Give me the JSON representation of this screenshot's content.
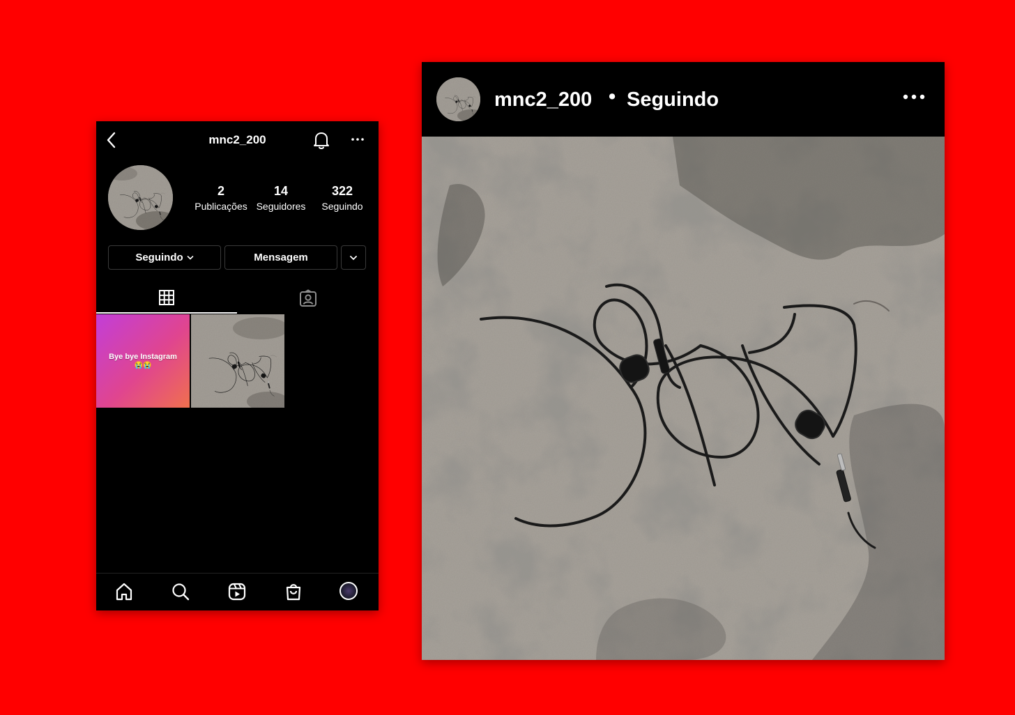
{
  "profile": {
    "username": "mnc2_200",
    "stats": [
      {
        "value": "2",
        "label": "Publicações"
      },
      {
        "value": "14",
        "label": "Seguidores"
      },
      {
        "value": "322",
        "label": "Seguindo"
      }
    ],
    "buttons": {
      "following": "Seguindo",
      "message": "Mensagem"
    },
    "posts": [
      {
        "caption": "Bye bye Instagram",
        "emoji": "😭😭"
      }
    ],
    "icons": {
      "back": "chevron-left-icon",
      "notifications": "bell-icon",
      "more": "more-horizontal-icon",
      "grid": "grid-icon",
      "tagged": "tagged-user-icon",
      "home": "home-icon",
      "search": "search-icon",
      "reels": "reels-icon",
      "shop": "shop-bag-icon"
    }
  },
  "post": {
    "username": "mnc2_200",
    "separator": "•",
    "status": "Seguindo"
  },
  "colors": {
    "background": "#ff0000",
    "app_bg": "#000000",
    "text": "#ffffff"
  }
}
